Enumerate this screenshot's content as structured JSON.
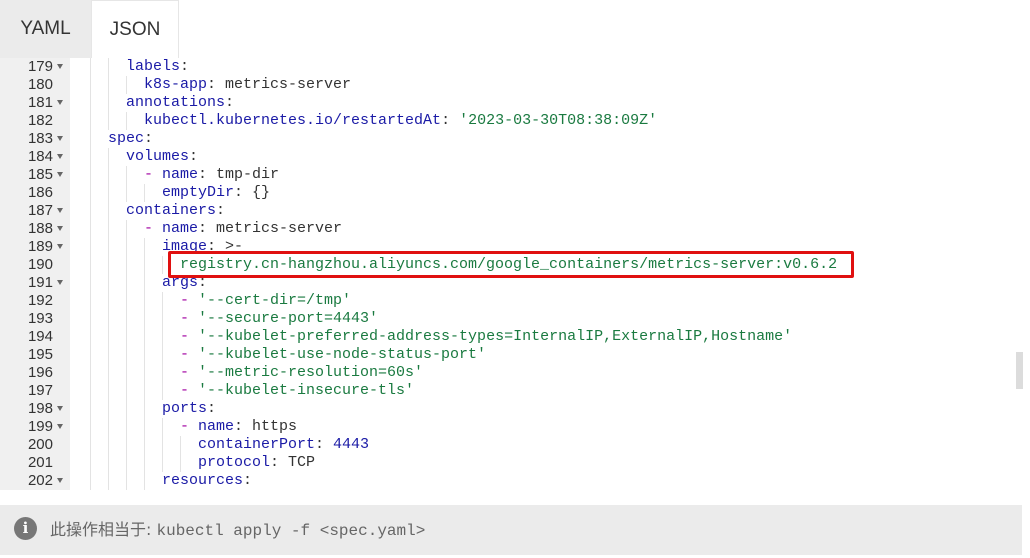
{
  "tabs": [
    "YAML",
    "JSON"
  ],
  "editor": {
    "lines": [
      {
        "n": "179",
        "fold": true,
        "indent": 2,
        "parts": [
          [
            "k",
            "labels"
          ],
          [
            "v",
            ":"
          ]
        ]
      },
      {
        "n": "180",
        "fold": false,
        "indent": 3,
        "parts": [
          [
            "k",
            "k8s-app"
          ],
          [
            "v",
            ": metrics-server"
          ]
        ]
      },
      {
        "n": "181",
        "fold": true,
        "indent": 2,
        "parts": [
          [
            "k",
            "annotations"
          ],
          [
            "v",
            ":"
          ]
        ]
      },
      {
        "n": "182",
        "fold": false,
        "indent": 3,
        "parts": [
          [
            "k",
            "kubectl.kubernetes.io/restartedAt"
          ],
          [
            "v",
            ": "
          ],
          [
            "s",
            "'2023-03-30T08:38:09Z'"
          ]
        ]
      },
      {
        "n": "183",
        "fold": true,
        "indent": 1,
        "parts": [
          [
            "k",
            "spec"
          ],
          [
            "v",
            ":"
          ]
        ]
      },
      {
        "n": "184",
        "fold": true,
        "indent": 2,
        "parts": [
          [
            "k",
            "volumes"
          ],
          [
            "v",
            ":"
          ]
        ]
      },
      {
        "n": "185",
        "fold": true,
        "indent": 3,
        "parts": [
          [
            "d",
            "- "
          ],
          [
            "k",
            "name"
          ],
          [
            "v",
            ": tmp-dir"
          ]
        ]
      },
      {
        "n": "186",
        "fold": false,
        "indent": 4,
        "parts": [
          [
            "k",
            "emptyDir"
          ],
          [
            "v",
            ": {}"
          ]
        ]
      },
      {
        "n": "187",
        "fold": true,
        "indent": 2,
        "parts": [
          [
            "k",
            "containers"
          ],
          [
            "v",
            ":"
          ]
        ]
      },
      {
        "n": "188",
        "fold": true,
        "indent": 3,
        "parts": [
          [
            "d",
            "- "
          ],
          [
            "k",
            "name"
          ],
          [
            "v",
            ": metrics-server"
          ]
        ]
      },
      {
        "n": "189",
        "fold": true,
        "indent": 4,
        "parts": [
          [
            "k",
            "image"
          ],
          [
            "v",
            ": >-"
          ]
        ]
      },
      {
        "n": "190",
        "fold": false,
        "indent": 5,
        "parts": [
          [
            "s",
            "registry.cn-hangzhou.aliyuncs.com/google_containers/metrics-server:v0.6.2"
          ]
        ]
      },
      {
        "n": "191",
        "fold": true,
        "indent": 4,
        "parts": [
          [
            "k",
            "args"
          ],
          [
            "v",
            ":"
          ]
        ]
      },
      {
        "n": "192",
        "fold": false,
        "indent": 5,
        "parts": [
          [
            "d",
            "- "
          ],
          [
            "s",
            "'--cert-dir=/tmp'"
          ]
        ]
      },
      {
        "n": "193",
        "fold": false,
        "indent": 5,
        "parts": [
          [
            "d",
            "- "
          ],
          [
            "s",
            "'--secure-port=4443'"
          ]
        ]
      },
      {
        "n": "194",
        "fold": false,
        "indent": 5,
        "parts": [
          [
            "d",
            "- "
          ],
          [
            "s",
            "'--kubelet-preferred-address-types=InternalIP,ExternalIP,Hostname'"
          ]
        ]
      },
      {
        "n": "195",
        "fold": false,
        "indent": 5,
        "parts": [
          [
            "d",
            "- "
          ],
          [
            "s",
            "'--kubelet-use-node-status-port'"
          ]
        ]
      },
      {
        "n": "196",
        "fold": false,
        "indent": 5,
        "parts": [
          [
            "d",
            "- "
          ],
          [
            "s",
            "'--metric-resolution=60s'"
          ]
        ]
      },
      {
        "n": "197",
        "fold": false,
        "indent": 5,
        "parts": [
          [
            "d",
            "- "
          ],
          [
            "s",
            "'--kubelet-insecure-tls'"
          ]
        ]
      },
      {
        "n": "198",
        "fold": true,
        "indent": 4,
        "parts": [
          [
            "k",
            "ports"
          ],
          [
            "v",
            ":"
          ]
        ]
      },
      {
        "n": "199",
        "fold": true,
        "indent": 5,
        "parts": [
          [
            "d",
            "- "
          ],
          [
            "k",
            "name"
          ],
          [
            "v",
            ": https"
          ]
        ]
      },
      {
        "n": "200",
        "fold": false,
        "indent": 6,
        "parts": [
          [
            "k",
            "containerPort"
          ],
          [
            "v",
            ": "
          ],
          [
            "n",
            "4443"
          ]
        ]
      },
      {
        "n": "201",
        "fold": false,
        "indent": 6,
        "parts": [
          [
            "k",
            "protocol"
          ],
          [
            "v",
            ": TCP"
          ]
        ]
      },
      {
        "n": "202",
        "fold": true,
        "indent": 4,
        "parts": [
          [
            "k",
            "resources"
          ],
          [
            "v",
            ":"
          ]
        ]
      }
    ]
  },
  "footer": {
    "prefix": "此操作相当于: ",
    "command": "kubectl apply -f <spec.yaml>"
  },
  "colors": {
    "highlight_border": "#e01010",
    "key": "#1a1aa6",
    "string": "#1a7a40",
    "dash": "#a000a0"
  }
}
